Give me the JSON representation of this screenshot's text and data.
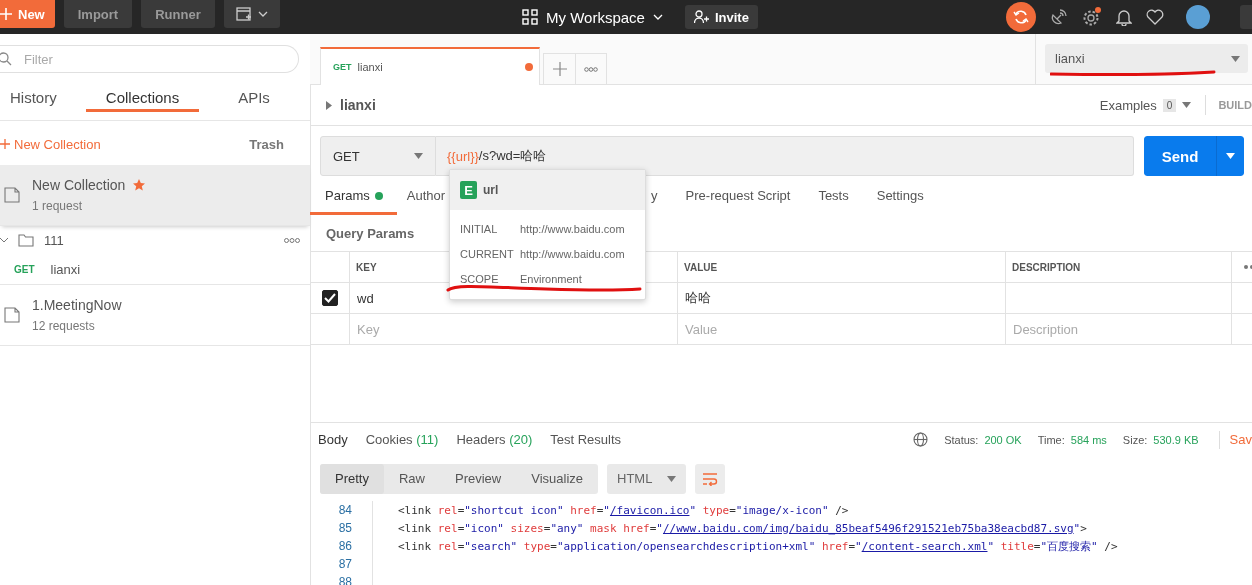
{
  "topbar": {
    "buttons": [
      {
        "kind": "primary",
        "label": "New"
      },
      {
        "kind": "plain",
        "label": "Import"
      },
      {
        "kind": "plain",
        "label": "Runner"
      },
      {
        "kind": "window"
      }
    ],
    "workspace": "My Workspace",
    "invite": "Invite"
  },
  "sidebar": {
    "filter_placeholder": "Filter",
    "tabs": [
      {
        "label": "History",
        "selected": false
      },
      {
        "label": "Collections",
        "selected": true
      },
      {
        "label": "APIs",
        "selected": false
      }
    ],
    "new_collection": "New Collection",
    "trash": "Trash",
    "collections": [
      {
        "kind": "collection",
        "name": "New Collection",
        "count": "1 request",
        "starred": true,
        "selected": true
      },
      {
        "kind": "folder",
        "name": "111",
        "expanded": true,
        "children": [
          {
            "method": "GET",
            "name": "lianxi"
          }
        ]
      },
      {
        "kind": "collection",
        "name": "1.MeetingNow",
        "count": "12 requests",
        "starred": false,
        "selected": false
      }
    ]
  },
  "request_tabs": [
    {
      "method": "GET",
      "name": "lianxi",
      "unsaved": true,
      "selected": true
    }
  ],
  "environment": {
    "value": "lianxi"
  },
  "request": {
    "name": "lianxi",
    "examples_label": "Examples",
    "examples_count": "0",
    "build": "BUILD",
    "method": "GET",
    "url_variable": "{{url}}",
    "url_rest": "/s?wd=哈哈",
    "send": "Send",
    "tabs": [
      {
        "label": "Params",
        "indicator": true,
        "selected": true
      },
      {
        "label": "Author",
        "indicator": false,
        "selected": false
      },
      {
        "label": "y",
        "indicator": false,
        "selected": false
      },
      {
        "label": "Pre-request Script",
        "indicator": false,
        "selected": false
      },
      {
        "label": "Tests",
        "indicator": false,
        "selected": false
      },
      {
        "label": "Settings",
        "indicator": false,
        "selected": false
      }
    ],
    "query_params_title": "Query Params",
    "columns": [
      "KEY",
      "VALUE",
      "DESCRIPTION"
    ],
    "rows": [
      {
        "checked": true,
        "key": "wd",
        "value": "哈哈"
      }
    ],
    "placeholder_row": {
      "key_placeholder": "Key",
      "value_placeholder": "Value",
      "description_placeholder": "Description"
    }
  },
  "variable_popup": {
    "badge": "E",
    "name": "url",
    "rows": [
      {
        "label": "INITIAL",
        "value": "http://www.baidu.com"
      },
      {
        "label": "CURRENT",
        "value": "http://www.baidu.com"
      },
      {
        "label": "SCOPE",
        "value": "Environment"
      }
    ]
  },
  "response": {
    "tabs": [
      {
        "label": "Body",
        "selected": true
      },
      {
        "label": "Cookies",
        "count": "(11)",
        "selected": false
      },
      {
        "label": "Headers",
        "count": "(20)",
        "selected": false
      },
      {
        "label": "Test Results",
        "selected": false
      }
    ],
    "status_label": "Status:",
    "status": "200 OK",
    "time_label": "Time:",
    "time": "584 ms",
    "size_label": "Size:",
    "size": "530.9 KB",
    "save": "Sav",
    "view_modes": [
      {
        "label": "Pretty",
        "selected": true
      },
      {
        "label": "Raw",
        "selected": false
      },
      {
        "label": "Preview",
        "selected": false
      },
      {
        "label": "Visualize",
        "selected": false
      }
    ],
    "format": "HTML",
    "code_lines": [
      {
        "number": "84",
        "segments": [
          {
            "kind": "tag",
            "text": "<link"
          },
          {
            "kind": "attr",
            "text": " rel"
          },
          {
            "kind": "punct",
            "text": "="
          },
          {
            "kind": "value",
            "text": "\"shortcut icon\""
          },
          {
            "kind": "attr",
            "text": " href"
          },
          {
            "kind": "punct",
            "text": "="
          },
          {
            "kind": "value",
            "text": "\""
          },
          {
            "kind": "link",
            "text": "/favicon.ico"
          },
          {
            "kind": "value",
            "text": "\""
          },
          {
            "kind": "attr",
            "text": " type"
          },
          {
            "kind": "punct",
            "text": "="
          },
          {
            "kind": "value",
            "text": "\"image/x-icon\""
          },
          {
            "kind": "tag",
            "text": " />"
          }
        ]
      },
      {
        "number": "85",
        "segments": [
          {
            "kind": "tag",
            "text": "<link"
          },
          {
            "kind": "attr",
            "text": " rel"
          },
          {
            "kind": "punct",
            "text": "="
          },
          {
            "kind": "value",
            "text": "\"icon\""
          },
          {
            "kind": "attr",
            "text": " sizes"
          },
          {
            "kind": "punct",
            "text": "="
          },
          {
            "kind": "value",
            "text": "\"any\""
          },
          {
            "kind": "attr",
            "text": " mask href"
          },
          {
            "kind": "punct",
            "text": "="
          },
          {
            "kind": "value",
            "text": "\""
          },
          {
            "kind": "link",
            "text": "//www.baidu.com/img/baidu_85beaf5496f291521eb75ba38eacbd87.svg"
          },
          {
            "kind": "value",
            "text": "\""
          },
          {
            "kind": "tag",
            "text": ">"
          }
        ]
      },
      {
        "number": "86",
        "segments": [
          {
            "kind": "tag",
            "text": "<link"
          },
          {
            "kind": "attr",
            "text": " rel"
          },
          {
            "kind": "punct",
            "text": "="
          },
          {
            "kind": "value",
            "text": "\"search\""
          },
          {
            "kind": "attr",
            "text": " type"
          },
          {
            "kind": "punct",
            "text": "="
          },
          {
            "kind": "value",
            "text": "\"application/opensearchdescription+xml\""
          },
          {
            "kind": "attr",
            "text": " href"
          },
          {
            "kind": "punct",
            "text": "="
          },
          {
            "kind": "value",
            "text": "\""
          },
          {
            "kind": "link",
            "text": "/content-search.xml"
          },
          {
            "kind": "value",
            "text": "\""
          },
          {
            "kind": "attr",
            "text": " title"
          },
          {
            "kind": "punct",
            "text": "="
          },
          {
            "kind": "value",
            "text": "\"百度搜索\""
          },
          {
            "kind": "tag",
            "text": " />"
          }
        ]
      },
      {
        "number": "87"
      },
      {
        "number": "88"
      }
    ]
  }
}
